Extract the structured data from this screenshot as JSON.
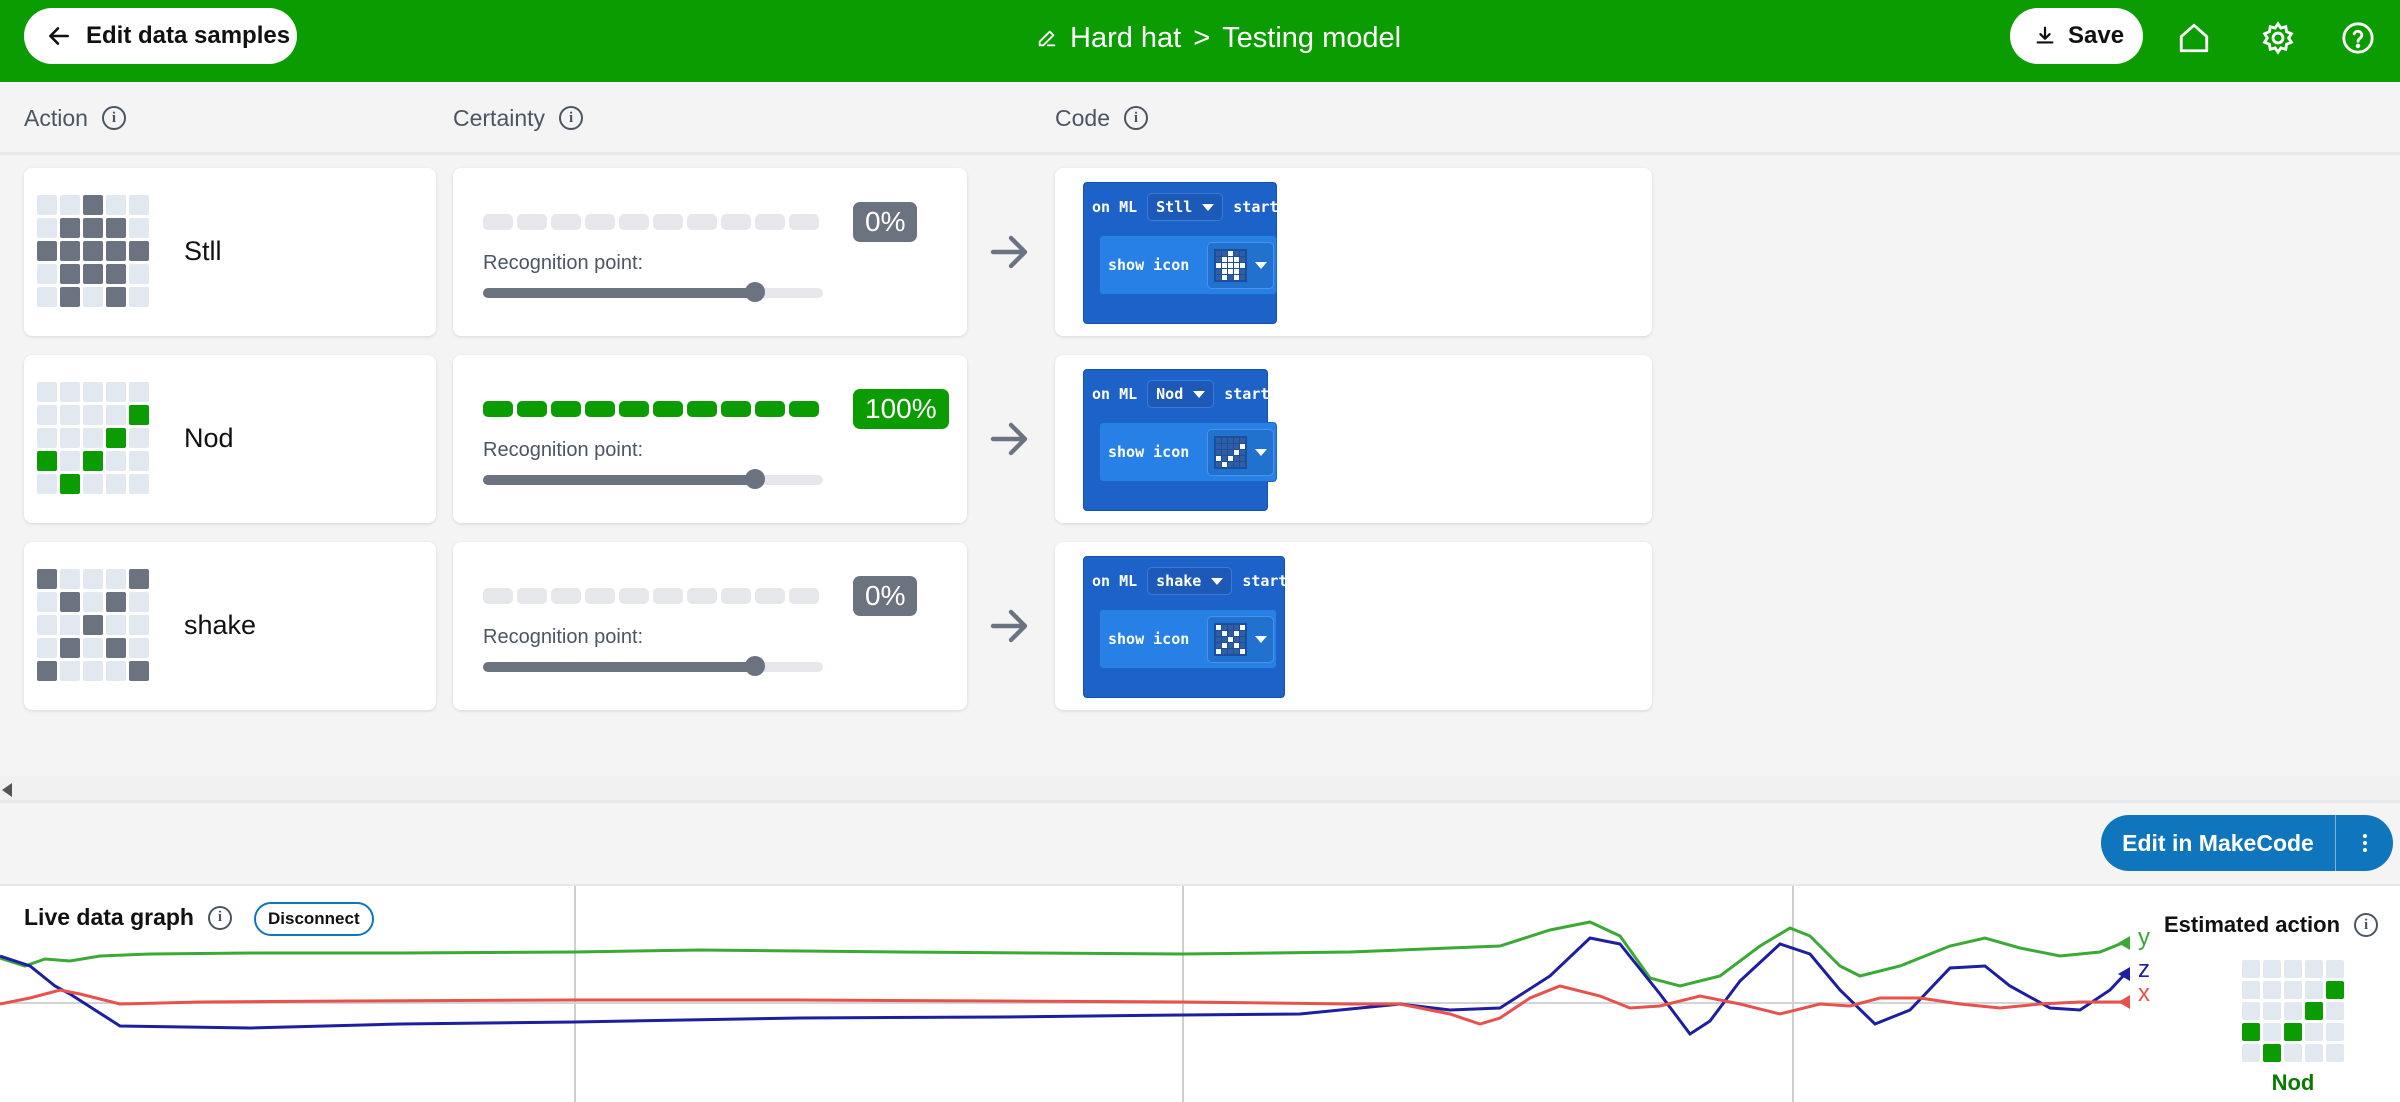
{
  "header": {
    "back_label": "Edit data samples",
    "project_name": "Hard hat",
    "breadcrumb_sep": ">",
    "page_name": "Testing model",
    "save_label": "Save",
    "bg_color": "#0a9c00"
  },
  "columns": {
    "action": "Action",
    "certainty": "Certainty",
    "code": "Code"
  },
  "actions": [
    {
      "name": "Stll",
      "certainty": "0%",
      "certainty_value": 0,
      "recognition_label": "Recognition point:",
      "recognition_point": 0.8,
      "code": {
        "on_ml": "on ML",
        "dropdown": "Stll",
        "start": "start",
        "show_icon": "show icon"
      },
      "grid": [
        0,
        0,
        1,
        0,
        0,
        0,
        1,
        1,
        1,
        0,
        1,
        1,
        1,
        1,
        1,
        0,
        1,
        1,
        1,
        0,
        0,
        1,
        0,
        1,
        0
      ]
    },
    {
      "name": "Nod",
      "certainty": "100%",
      "certainty_value": 1,
      "recognition_label": "Recognition point:",
      "recognition_point": 0.8,
      "code": {
        "on_ml": "on ML",
        "dropdown": "Nod",
        "start": "start",
        "show_icon": "show icon"
      },
      "grid": [
        0,
        0,
        0,
        0,
        0,
        0,
        0,
        0,
        0,
        1,
        0,
        0,
        0,
        1,
        0,
        1,
        0,
        1,
        0,
        0,
        0,
        1,
        0,
        0,
        0
      ]
    },
    {
      "name": "shake",
      "certainty": "0%",
      "certainty_value": 0,
      "recognition_label": "Recognition point:",
      "recognition_point": 0.8,
      "code": {
        "on_ml": "on ML",
        "dropdown": "shake",
        "start": "start",
        "show_icon": "show icon"
      },
      "grid": [
        1,
        0,
        0,
        0,
        1,
        0,
        1,
        0,
        1,
        0,
        0,
        0,
        1,
        0,
        0,
        0,
        1,
        0,
        1,
        0,
        1,
        0,
        0,
        0,
        1
      ]
    }
  ],
  "makecode_button": "Edit in MakeCode",
  "graph": {
    "title": "Live data graph",
    "disconnect_label": "Disconnect",
    "axes": [
      {
        "label": "y",
        "color": "#3aa935"
      },
      {
        "label": "z",
        "color": "#1e1ea0"
      },
      {
        "label": "x",
        "color": "#e8524e"
      }
    ]
  },
  "estimated": {
    "title": "Estimated action",
    "name": "Nod",
    "grid": [
      0,
      0,
      0,
      0,
      0,
      0,
      0,
      0,
      0,
      1,
      0,
      0,
      0,
      1,
      0,
      1,
      0,
      1,
      0,
      0,
      0,
      1,
      0,
      0,
      0
    ]
  }
}
